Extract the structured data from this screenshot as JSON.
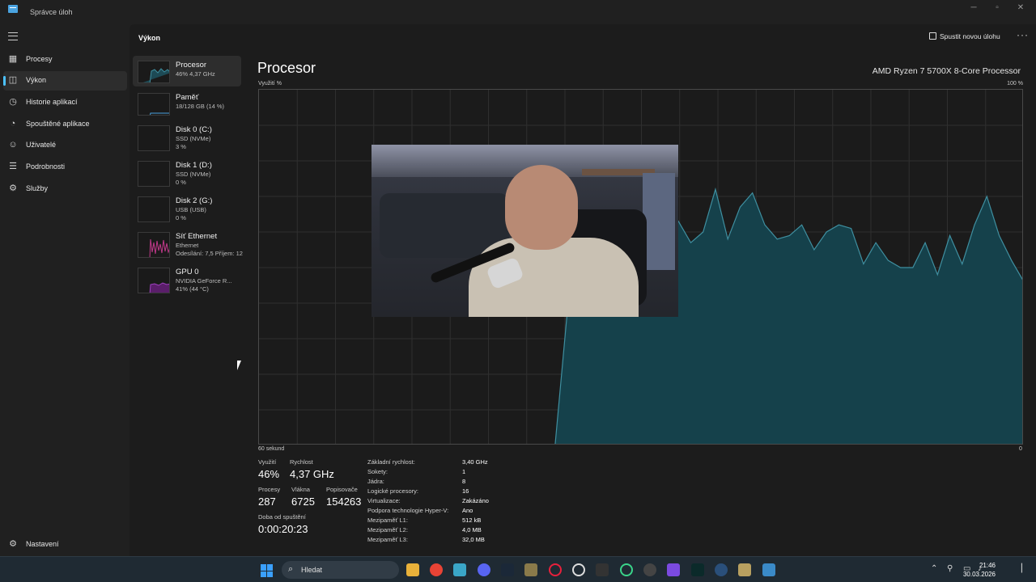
{
  "window": {
    "title": "Správce úloh"
  },
  "nav": {
    "items": [
      {
        "label": "Procesy",
        "icon": "processes-icon"
      },
      {
        "label": "Výkon",
        "icon": "performance-icon"
      },
      {
        "label": "Historie aplikací",
        "icon": "app-history-icon"
      },
      {
        "label": "Spouštěné aplikace",
        "icon": "startup-apps-icon"
      },
      {
        "label": "Uživatelé",
        "icon": "users-icon"
      },
      {
        "label": "Podrobnosti",
        "icon": "details-icon"
      },
      {
        "label": "Služby",
        "icon": "services-icon"
      }
    ],
    "settings_label": "Nastavení"
  },
  "header": {
    "title": "Výkon",
    "run_task_label": "Spustit novou úlohu",
    "more_label": "···"
  },
  "resources": [
    {
      "name": "Procesor",
      "sub1": "46% 4,37 GHz",
      "sub2": ""
    },
    {
      "name": "Paměť",
      "sub1": "18/128 GB (14 %)",
      "sub2": ""
    },
    {
      "name": "Disk 0 (C:)",
      "sub1": "SSD (NVMe)",
      "sub2": "3 %"
    },
    {
      "name": "Disk 1 (D:)",
      "sub1": "SSD (NVMe)",
      "sub2": "0 %"
    },
    {
      "name": "Disk 2 (G:)",
      "sub1": "USB (USB)",
      "sub2": "0 %"
    },
    {
      "name": "Síť Ethernet",
      "sub1": "Ethernet",
      "sub2": "Odesílání: 7,5 Příjem: 12"
    },
    {
      "name": "GPU 0",
      "sub1": "NVIDIA GeForce R...",
      "sub2": "41% (44 °C)"
    }
  ],
  "panel": {
    "title": "Procesor",
    "cpu_model": "AMD Ryzen 7 5700X 8-Core Processor",
    "y_label": "Využití %",
    "y_max_label": "100 %",
    "x_label": "60 sekund",
    "x_min_label": "0"
  },
  "chart_data": {
    "type": "area",
    "xlabel": "60 sekund",
    "ylabel": "Využití %",
    "ylim": [
      0,
      100
    ],
    "x": [
      60,
      59,
      58,
      57,
      56,
      55,
      54,
      53,
      52,
      51,
      50,
      49,
      48,
      47,
      46,
      45,
      44,
      43,
      42,
      41,
      40,
      39,
      38,
      37,
      36,
      35,
      34,
      33,
      32,
      31,
      30,
      29,
      28,
      27,
      26,
      25,
      24,
      23,
      22,
      21,
      20,
      19,
      18,
      17,
      16,
      15,
      14,
      13,
      12,
      11,
      10,
      9,
      8,
      7,
      6,
      5,
      4,
      3,
      2,
      1,
      0
    ],
    "values": [
      0,
      0,
      0,
      0,
      0,
      0,
      0,
      0,
      0,
      0,
      0,
      0,
      0,
      0,
      0,
      0,
      0,
      0,
      0,
      0,
      0,
      0,
      0,
      0,
      0,
      38,
      45,
      52,
      60,
      62,
      64,
      68,
      63,
      68,
      63,
      57,
      60,
      72,
      58,
      67,
      71,
      62,
      58,
      59,
      62,
      55,
      60,
      62,
      61,
      51,
      57,
      52,
      50,
      50,
      57,
      48,
      59,
      51,
      62,
      70,
      59,
      52,
      46
    ],
    "grid": true
  },
  "stats": {
    "utilization_label": "Využití",
    "utilization_value": "46%",
    "speed_label": "Rychlost",
    "speed_value": "4,37 GHz",
    "processes_label": "Procesy",
    "processes_value": "287",
    "threads_label": "Vlákna",
    "threads_value": "6725",
    "handles_label": "Popisovače",
    "handles_value": "154263",
    "uptime_label": "Doba od spuštění",
    "uptime_value": "0:00:20:23"
  },
  "properties": [
    {
      "k": "Základní rychlost:",
      "v": "3,40 GHz"
    },
    {
      "k": "Sokety:",
      "v": "1"
    },
    {
      "k": "Jádra:",
      "v": "8"
    },
    {
      "k": "Logické procesory:",
      "v": "16"
    },
    {
      "k": "Virtualizace:",
      "v": "Zakázáno"
    },
    {
      "k": "Podpora technologie Hyper-V:",
      "v": "Ano"
    },
    {
      "k": "Mezipaměť L1:",
      "v": "512 kB"
    },
    {
      "k": "Mezipaměť L2:",
      "v": "4,0 MB"
    },
    {
      "k": "Mezipaměť L3:",
      "v": "32,0 MB"
    }
  ],
  "taskbar": {
    "search_label": "Hledat",
    "time": "21:46",
    "date": "30.03.2026",
    "apps": [
      "file-explorer-icon",
      "chrome-icon",
      "monitor-icon",
      "discord-icon",
      "steam-icon",
      "game-icon",
      "opera-icon",
      "chatgpt-icon",
      "epic-icon",
      "circle-app-icon",
      "obs-icon",
      "grid-app-icon",
      "terminal-icon",
      "anchor-app-icon",
      "package-app-icon",
      "task-manager-icon"
    ]
  },
  "colors": {
    "accent": "#4cc2ff",
    "cpu_line": "#3f8fa0",
    "cpu_fill": "#15414b",
    "grid": "#2f2f2f"
  }
}
